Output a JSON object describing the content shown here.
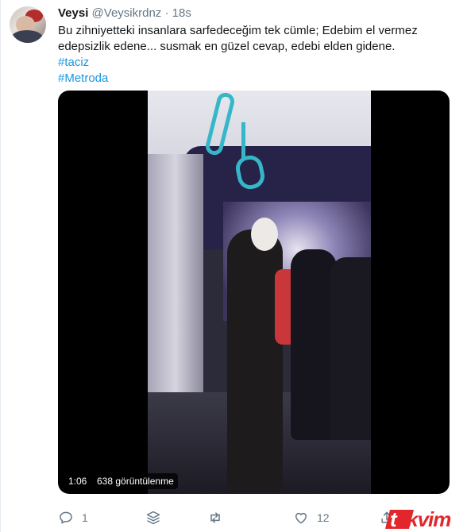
{
  "tweet": {
    "author_name": "Veysi",
    "author_handle": "@Veysikrdnz",
    "separator": "·",
    "time": "18s",
    "text_lines": [
      "Bu zihniyetteki insanlara sarfedeceğim tek cümle; Edebim el vermez",
      "edepsizlik edene... susmak en güzel cevap, edebi elden gidene."
    ],
    "hashtags": [
      "#taciz",
      "#Metroda"
    ]
  },
  "video": {
    "duration": "1:06",
    "views": "638 görüntülenme"
  },
  "actions": {
    "reply_count": "1",
    "retweet_count": "",
    "like_count": "12"
  },
  "watermark": {
    "text_t": "t",
    "text_rest": "akvim"
  },
  "colors": {
    "link": "#1b95e0",
    "secondary_text": "#657786",
    "watermark_red": "#e3262b"
  }
}
